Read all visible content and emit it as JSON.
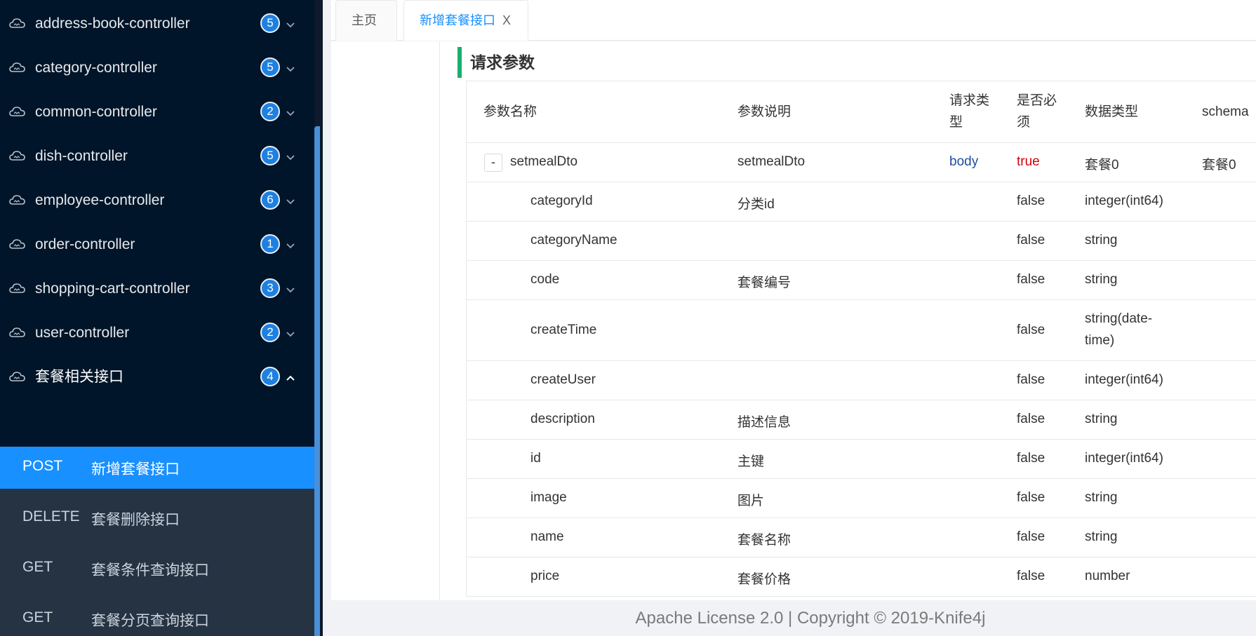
{
  "sidebar": {
    "groups": [
      {
        "label": "address-book-controller",
        "count": "5"
      },
      {
        "label": "category-controller",
        "count": "5"
      },
      {
        "label": "common-controller",
        "count": "2"
      },
      {
        "label": "dish-controller",
        "count": "5"
      },
      {
        "label": "employee-controller",
        "count": "6"
      },
      {
        "label": "order-controller",
        "count": "1"
      },
      {
        "label": "shopping-cart-controller",
        "count": "3"
      },
      {
        "label": "user-controller",
        "count": "2"
      },
      {
        "label": "套餐相关接口",
        "count": "4"
      }
    ],
    "apis": [
      {
        "method": "POST",
        "name": "新增套餐接口"
      },
      {
        "method": "DELETE",
        "name": "套餐删除接口"
      },
      {
        "method": "GET",
        "name": "套餐条件查询接口"
      },
      {
        "method": "GET",
        "name": "套餐分页查询接口"
      }
    ]
  },
  "tabs": [
    {
      "label": "主页"
    },
    {
      "label": "新增套餐接口",
      "close": "X"
    }
  ],
  "section_title": "请求参数",
  "table": {
    "headers": {
      "name": "参数名称",
      "desc": "参数说明",
      "in_1": "请求类",
      "in_2": "型",
      "req_1": "是否必",
      "req_2": "须",
      "type": "数据类型",
      "schema": "schema"
    },
    "root": {
      "toggle": "-",
      "name": "setmealDto",
      "desc": "setmealDto",
      "in": "body",
      "required": "true",
      "type": "套餐0",
      "schema": "套餐0"
    },
    "rows": [
      {
        "name": "categoryId",
        "desc": "分类id",
        "required": "false",
        "type": "integer(int64)",
        "type_2": ""
      },
      {
        "name": "categoryName",
        "desc": "",
        "required": "false",
        "type": "string",
        "type_2": ""
      },
      {
        "name": "code",
        "desc": "套餐编号",
        "required": "false",
        "type": "string",
        "type_2": ""
      },
      {
        "name": "createTime",
        "desc": "",
        "required": "false",
        "type": "string(date-",
        "type_2": "time)"
      },
      {
        "name": "createUser",
        "desc": "",
        "required": "false",
        "type": "integer(int64)",
        "type_2": ""
      },
      {
        "name": "description",
        "desc": "描述信息",
        "required": "false",
        "type": "string",
        "type_2": ""
      },
      {
        "name": "id",
        "desc": "主键",
        "required": "false",
        "type": "integer(int64)",
        "type_2": ""
      },
      {
        "name": "image",
        "desc": "图片",
        "required": "false",
        "type": "string",
        "type_2": ""
      },
      {
        "name": "name",
        "desc": "套餐名称",
        "required": "false",
        "type": "string",
        "type_2": ""
      },
      {
        "name": "price",
        "desc": "套餐价格",
        "required": "false",
        "type": "number",
        "type_2": ""
      }
    ]
  },
  "footer": "Apache License 2.0 | Copyright © 2019-Knife4j"
}
